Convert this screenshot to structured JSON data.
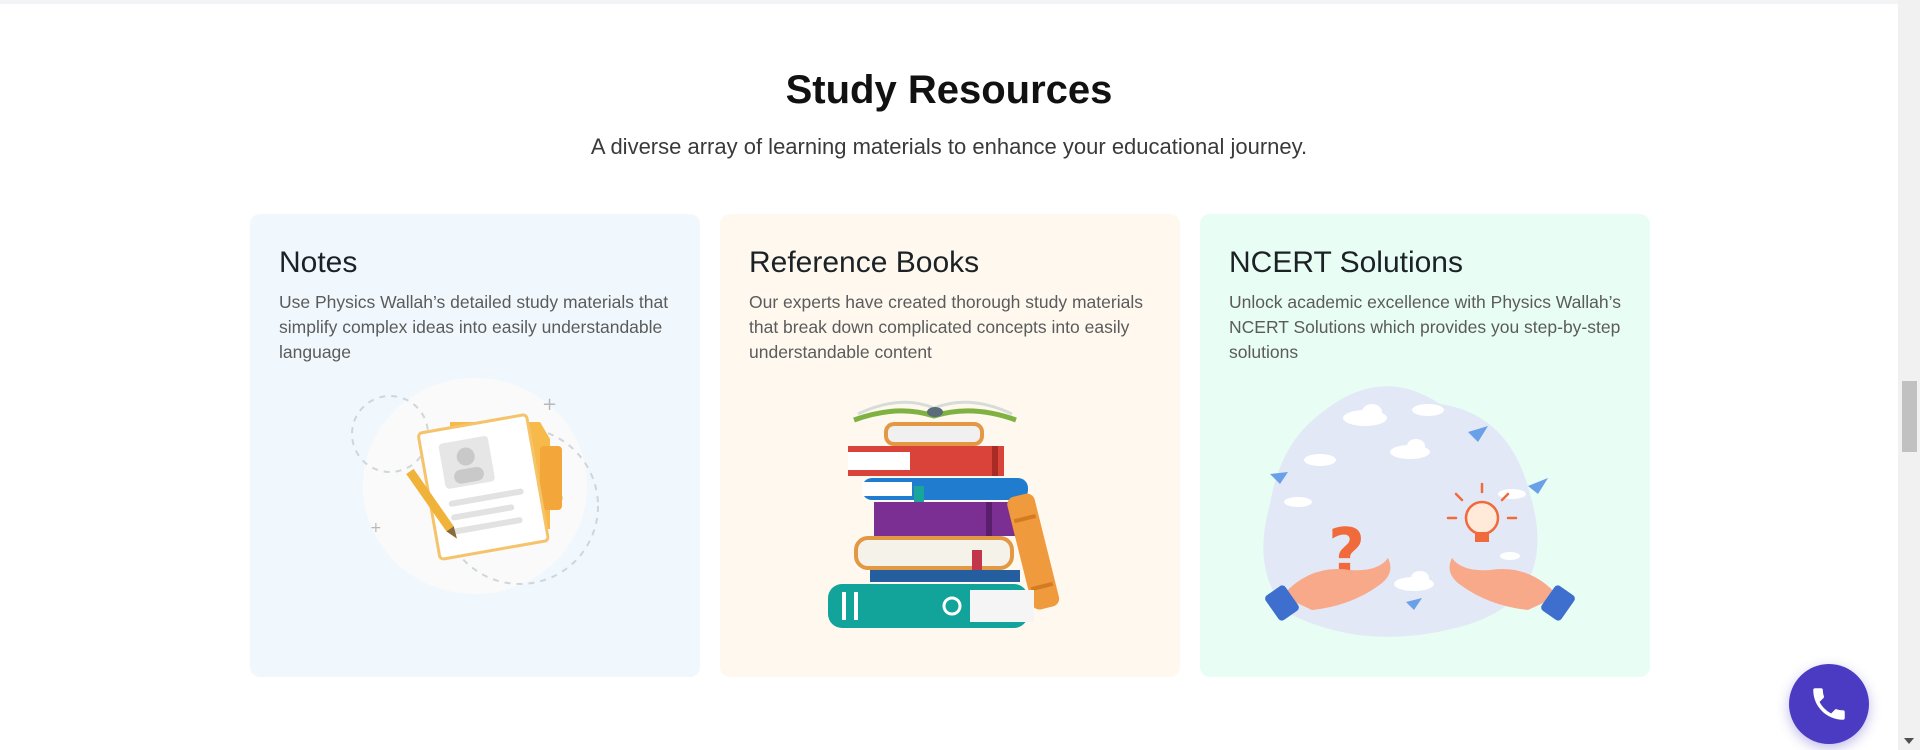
{
  "section": {
    "title": "Study Resources",
    "subtitle": "A diverse array of learning materials to enhance your educational journey."
  },
  "cards": [
    {
      "title": "Notes",
      "description": "Use Physics Wallah’s detailed study materials that simplify complex ideas into easily understandable language",
      "icon": "notes-illustration",
      "background": "#f1f8fd"
    },
    {
      "title": "Reference Books",
      "description": "Our experts have created thorough study materials that break down complicated concepts into easily understandable content",
      "icon": "books-stack-illustration",
      "background": "#fef8ef"
    },
    {
      "title": "NCERT Solutions",
      "description": "Unlock academic excellence with Physics Wallah’s NCERT Solutions which provides you step-by-step solutions",
      "icon": "question-answer-hands-illustration",
      "background": "#e8fdf4"
    }
  ],
  "floating": {
    "call_icon": "phone-icon",
    "accent": "#4a3bc2"
  }
}
